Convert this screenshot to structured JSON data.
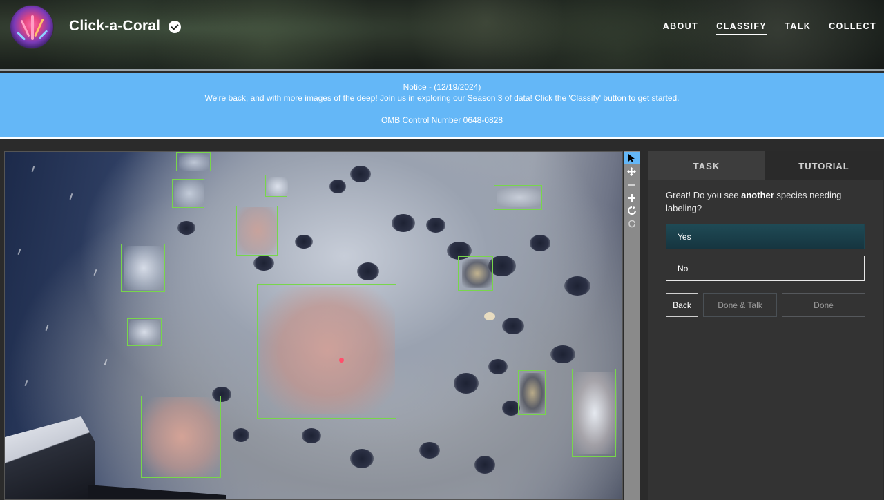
{
  "header": {
    "site_title": "Click-a-Coral",
    "verified_icon": "check-circle-icon",
    "nav": [
      {
        "label": "ABOUT",
        "active": false
      },
      {
        "label": "CLASSIFY",
        "active": true
      },
      {
        "label": "TALK",
        "active": false
      },
      {
        "label": "COLLECT",
        "active": false
      }
    ]
  },
  "notice": {
    "title": "Notice - (12/19/2024)",
    "message": "We're back, and with more images of the deep! Join us in exploring our Season 3 of data! Click the 'Classify' button to get started.",
    "omb": "OMB Control Number 0648-0828"
  },
  "viewer": {
    "annotation_count": 13
  },
  "tools": [
    {
      "icon": "pointer-icon",
      "label": "Annotate"
    },
    {
      "icon": "move-icon",
      "label": "Move"
    },
    {
      "icon": "zoom-out-icon",
      "label": "Zoom out"
    },
    {
      "icon": "zoom-in-icon",
      "label": "Zoom in"
    },
    {
      "icon": "rotate-icon",
      "label": "Rotate"
    },
    {
      "icon": "reset-icon",
      "label": "Reset"
    }
  ],
  "panel": {
    "tabs": [
      "TASK",
      "TUTORIAL"
    ],
    "question_prefix": "Great! Do you see ",
    "question_bold": "another",
    "question_suffix": " species needing labeling?",
    "answers": [
      "Yes",
      "No"
    ],
    "buttons": {
      "back": "Back",
      "done_talk": "Done & Talk",
      "done": "Done"
    }
  },
  "colors": {
    "notice_bg": "#64b7f7",
    "annotation_box": "#78d64b",
    "selected_answer": "#1f4a55",
    "panel_bg": "#333333"
  }
}
